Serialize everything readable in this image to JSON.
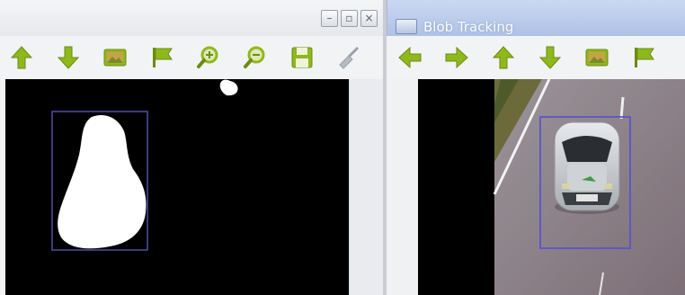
{
  "left_window": {
    "window_buttons": {
      "minimize": "–",
      "maximize": "▫",
      "close": "×"
    },
    "toolbar": [
      "arrow-up",
      "arrow-down",
      "image",
      "flag",
      "zoom-in",
      "zoom-out",
      "save",
      "broom"
    ],
    "view": {
      "content": "binary blob mask",
      "box_color": "#4a4a9a"
    }
  },
  "right_window": {
    "title": "Blob Tracking",
    "toolbar": [
      "arrow-left",
      "arrow-right",
      "arrow-up",
      "arrow-down",
      "image",
      "flag"
    ],
    "view": {
      "content": "road scene with tracked car",
      "box_color": "#5a55c8"
    }
  },
  "colors": {
    "toolbar_green": "#8fb81c",
    "mask": "#ffffff",
    "road": "#8d7f86"
  }
}
